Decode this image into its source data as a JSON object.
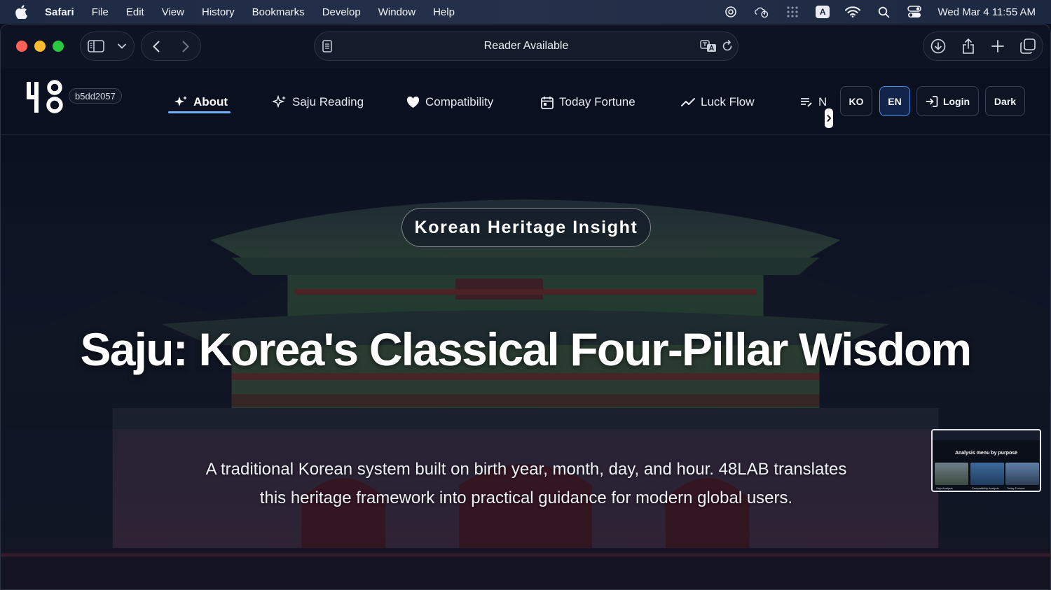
{
  "menubar": {
    "app": "Safari",
    "items": [
      "File",
      "Edit",
      "View",
      "History",
      "Bookmarks",
      "Develop",
      "Window",
      "Help"
    ],
    "input_badge": "A",
    "clock": "Wed Mar 4  11:55 AM"
  },
  "toolbar": {
    "address_text": "Reader Available"
  },
  "site": {
    "build_hash": "b5dd2057",
    "nav": [
      {
        "label": "About",
        "icon": "sparkle-icon",
        "active": true
      },
      {
        "label": "Saju Reading",
        "icon": "sparkle-icon"
      },
      {
        "label": "Compatibility",
        "icon": "heart-icon"
      },
      {
        "label": "Today Fortune",
        "icon": "calendar-icon"
      },
      {
        "label": "Luck Flow",
        "icon": "trend-icon"
      },
      {
        "label": "N",
        "icon": "notes-icon"
      }
    ],
    "lang_ko": "KO",
    "lang_en": "EN",
    "login": "Login",
    "theme": "Dark",
    "accent": "#6fb0ff"
  },
  "hero": {
    "badge": "Korean Heritage Insight",
    "title": "Saju: Korea's Classical Four-Pillar Wisdom",
    "subtitle_line1": "A traditional Korean system built on birth year, month, day, and hour. 48LAB translates",
    "subtitle_line2": "this heritage framework into practical guidance for modern global users."
  },
  "thumbnail": {
    "title": "Analysis menu by purpose",
    "captions": [
      "Saju Analysis",
      "Compatibility Analysis",
      "Today Fortune"
    ]
  }
}
